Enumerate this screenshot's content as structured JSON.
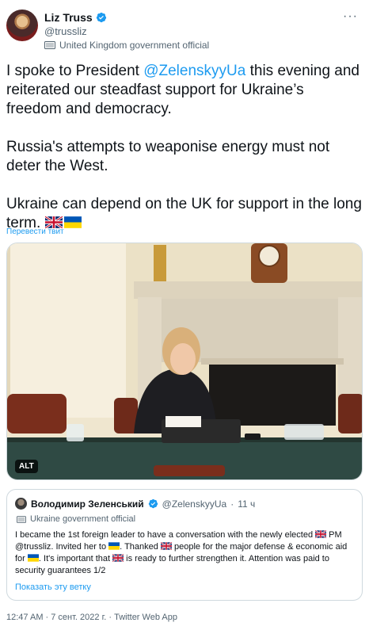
{
  "author": {
    "name": "Liz Truss",
    "handle": "@trussliz",
    "affiliation": "United Kingdom government official",
    "verified_icon": "verified-badge-icon"
  },
  "tweet": {
    "p1_before": "I spoke to President ",
    "p1_mention": "@ZelenskyyUa",
    "p1_after": " this evening and reiterated our steadfast support for Ukraine’s freedom and democracy.",
    "p2": "Russia's attempts to weaponise energy must not deter the West.",
    "p3": "Ukraine can depend on the UK for support in the long term.",
    "translate": "Перевести твит"
  },
  "media": {
    "alt_badge": "ALT"
  },
  "quote": {
    "name": "Володимир Зеленський",
    "handle": "@ZelenskyyUa",
    "separator": "·",
    "time": "11 ч",
    "affiliation": "Ukraine government official",
    "t1": "I became the 1st foreign leader to have a conversation with the newly elected ",
    "t2": " PM @trussliz. Invited her to ",
    "t3": ". Thanked ",
    "t4": " people for the major defense & economic aid for ",
    "t5": ". It's important that ",
    "t6": " is ready to further strengthen it. Attention was paid to security guarantees 1/2",
    "show_thread": "Показать эту ветку"
  },
  "meta": {
    "timestamp": "12:47 AM · 7 сент. 2022 г. · Twitter Web App"
  },
  "colors": {
    "accent": "#1d9bf0",
    "muted": "#536471",
    "text": "#0f1419"
  }
}
